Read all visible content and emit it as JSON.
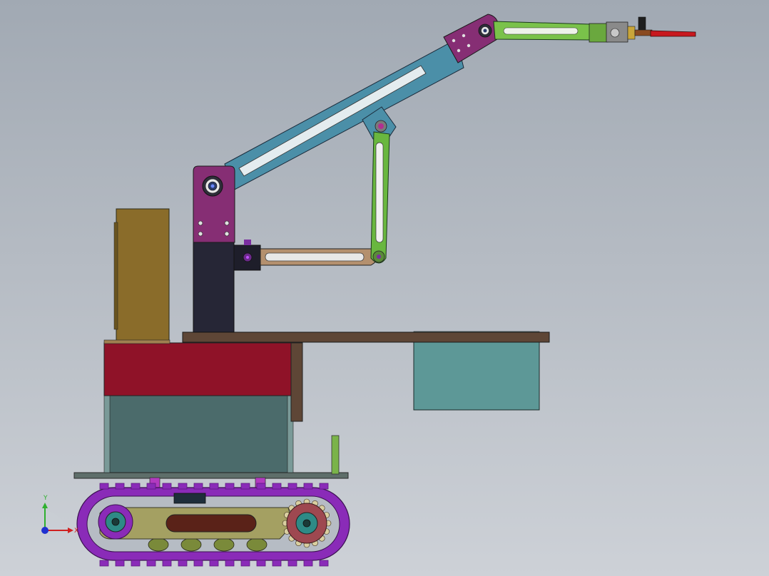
{
  "scene": {
    "colors": {
      "background_top": "#a1a9b3",
      "background_bottom": "#cdd1d7",
      "track": "#8a2bb8",
      "track_dark": "#5e1a80",
      "chassis_frame": "#a4a062",
      "sprocket": "#9e4850",
      "hub": "#2e8a86",
      "post": "#b23ac0",
      "deck": "#5e4636",
      "red_box": "#8f1228",
      "teal_box": "#4b6b6b",
      "gold_box": "#8a6c2a",
      "column": "#262636",
      "bracket": "#862e74",
      "upper_arm": "#4b8fa8",
      "link_green": "#69b73f",
      "rear_link": "#b4906e",
      "tray": "#5d9897",
      "forearm": "#7ac24a",
      "gripper": "#c8181e"
    },
    "icons": {
      "axis_triad": "coordinate-axis-triad-icon",
      "pivot": "pivot-bolt-icon"
    }
  },
  "axes": {
    "y_label": "Y",
    "x_label": "X"
  }
}
